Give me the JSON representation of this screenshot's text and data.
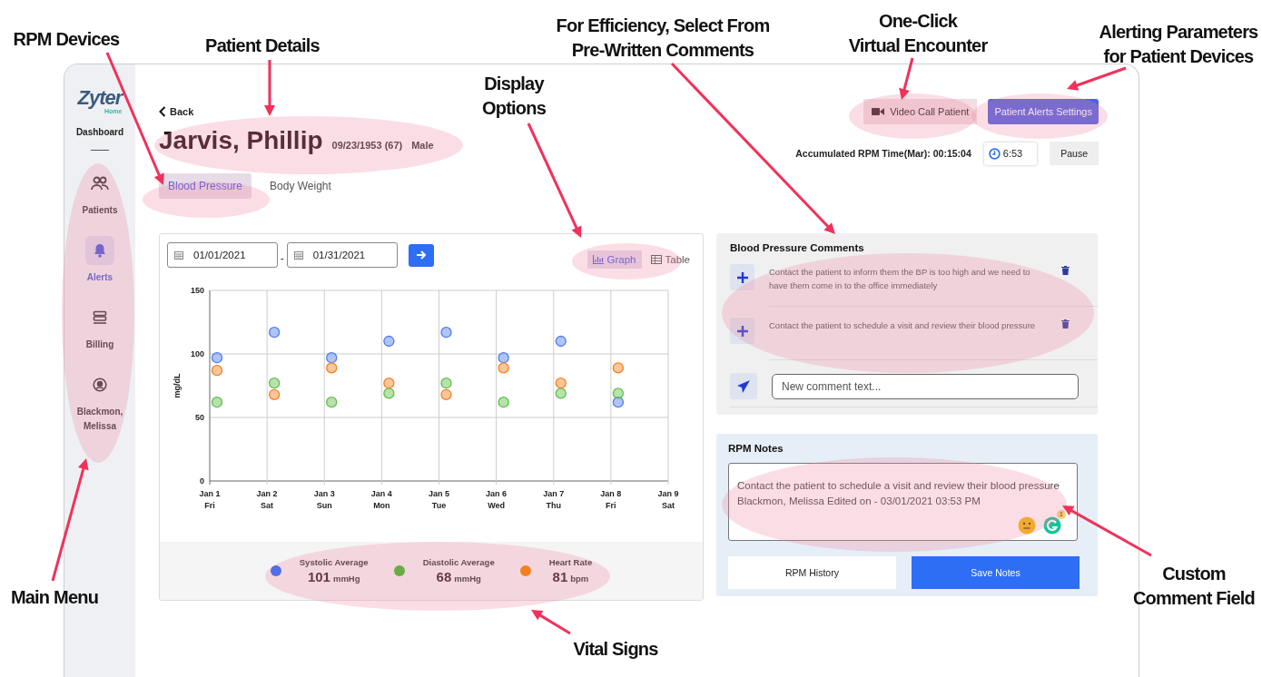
{
  "annotations": [
    {
      "lines": [
        "RPM Devices"
      ]
    },
    {
      "lines": [
        "Patient Details"
      ]
    },
    {
      "lines": [
        "Display",
        "Options"
      ]
    },
    {
      "lines": [
        "For Efficiency, Select From",
        "Pre-Written Comments"
      ]
    },
    {
      "lines": [
        "One-Click",
        "Virtual Encounter"
      ]
    },
    {
      "lines": [
        "Alerting Parameters",
        "for Patient Devices"
      ]
    },
    {
      "lines": [
        "Main Menu"
      ]
    },
    {
      "lines": [
        "Vital Signs"
      ]
    },
    {
      "lines": [
        "Custom",
        "Comment Field"
      ]
    }
  ],
  "sidebar": {
    "logo": "Zyter",
    "logo_sub": "Home",
    "dashboard": "Dashboard",
    "items": [
      {
        "label": "Patients",
        "kind": "users",
        "selected": false
      },
      {
        "label": "Alerts",
        "kind": "bell",
        "selected": true
      },
      {
        "label": "Billing",
        "kind": "stack",
        "selected": false
      },
      {
        "label": "Blackmon, Melissa",
        "kind": "user",
        "selected": false
      }
    ]
  },
  "header": {
    "back": "Back",
    "name": "Jarvis, Phillip",
    "dob": "09/23/1953 (67)",
    "gender": "Male"
  },
  "actions": {
    "video": "Video Call Patient",
    "alerts": "Patient Alerts Settings"
  },
  "timer": {
    "label": "Accumulated RPM Time(Mar): 00:15:04",
    "clock": "6:53",
    "pause": "Pause"
  },
  "tabs": [
    {
      "label": "Blood Pressure",
      "selected": true
    },
    {
      "label": "Body Weight",
      "selected": false
    }
  ],
  "dates": {
    "from": "01/01/2021",
    "separator": "-",
    "to": "01/31/2021"
  },
  "views": [
    {
      "label": "Graph",
      "kind": "graph",
      "selected": true
    },
    {
      "label": "Table",
      "kind": "table",
      "selected": false
    }
  ],
  "chart_data": {
    "type": "scatter",
    "grid": true,
    "ylabel": "mg/dL",
    "categories": [
      "Jan 1 Fri",
      "Jan 2 Sat",
      "Jan 3 Sun",
      "Jan 4 Mon",
      "Jan 5 Tue",
      "Jan 6 Wed",
      "Jan 7 Thu",
      "Jan 8 Fri",
      "Jan 9 Sat"
    ],
    "ylim": [
      0,
      150
    ],
    "yticks": [
      0,
      50,
      100,
      150
    ],
    "series": [
      {
        "color": "#4f7cf0",
        "values": [
          97,
          117,
          97,
          110,
          117,
          97,
          110,
          62,
          null
        ]
      },
      {
        "color": "#5fbf4a",
        "values": [
          62,
          77,
          62,
          69,
          77,
          62,
          69,
          69,
          null
        ]
      },
      {
        "color": "#f5801f",
        "values": [
          87,
          68,
          89,
          77,
          68,
          89,
          77,
          89,
          null
        ]
      }
    ]
  },
  "stats": [
    {
      "label": "Systolic Average",
      "value": "101",
      "unit": "mmHg",
      "color": "#4f6ee8"
    },
    {
      "label": "Diastolic Average",
      "value": "68",
      "unit": "mmHg",
      "color": "#6aab45"
    },
    {
      "label": "Heart Rate",
      "value": "81",
      "unit": "bpm",
      "color": "#f5801f"
    }
  ],
  "comments": {
    "title": "Blood Pressure Comments",
    "items": [
      {
        "text": "Contact the patient to inform them the BP is too high and we need to have them come in to the office immediately"
      },
      {
        "text": "Contact the patient to schedule a visit and review their blood pressure"
      }
    ],
    "placeholder": "New comment text..."
  },
  "notes": {
    "title": "RPM Notes",
    "value": "Contact the patient to schedule a visit and review their blood pressure\nBlackmon, Melissa Edited on - 03/01/2021 03:53 PM",
    "badge": "1",
    "history": "RPM History",
    "save": "Save Notes"
  }
}
